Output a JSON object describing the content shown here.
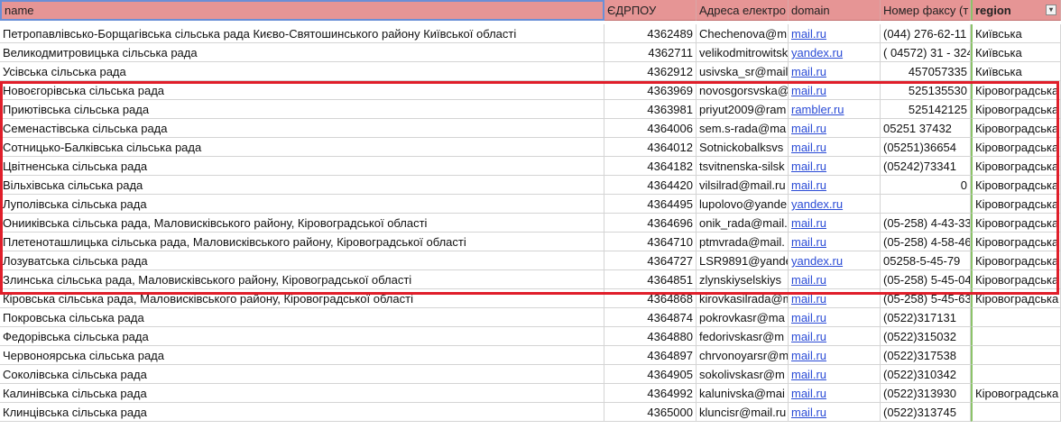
{
  "headers": [
    "name",
    "ЄДРПОУ",
    "Адреса електро",
    "domain",
    "Номер факсу (т",
    "region"
  ],
  "rows": [
    [
      "Петропавлівсько-Борщагівська сільська рада Києво-Святошинського району Київської області",
      "4362489",
      "Chechenova@m",
      "mail.ru",
      "(044) 276-62-11",
      "Київська"
    ],
    [
      "Великодмитровицька  сільська  рада",
      "4362711",
      "velikodmitrowitsk",
      "yandex.ru",
      "( 04572) 31 - 324",
      "Київська"
    ],
    [
      "Усівська сільська рада",
      "4362912",
      "usivska_sr@mail",
      "mail.ru",
      "457057335",
      "Київська"
    ],
    [
      "Новоєгорівська сільська рада",
      "4363969",
      "novosgorsvska@",
      "mail.ru",
      "525135530",
      "Кіровоградська"
    ],
    [
      "Приютівська сільська рада",
      "4363981",
      "priyut2009@ram",
      "rambler.ru",
      "525142125",
      "Кіровоградська"
    ],
    [
      "Семенастівська сільська рада",
      "4364006",
      "sem.s-rada@ma",
      "mail.ru",
      "05251 37432",
      "Кіровоградська"
    ],
    [
      "Сотницько-Балківська сільська рада",
      "4364012",
      "Sotnickobalksvs",
      "mail.ru",
      "(05251)36654",
      "Кіровоградська"
    ],
    [
      "Цвітненська сільська рада",
      "4364182",
      "tsvitnenska-silsk",
      "mail.ru",
      "(05242)73341",
      "Кіровоградська"
    ],
    [
      "Вільхівська сільська рада",
      "4364420",
      "vilsilrad@mail.ru",
      "mail.ru",
      "0",
      "Кіровоградська"
    ],
    [
      "Луполівська сільська рада",
      "4364495",
      "lupolovo@yande",
      "yandex.ru",
      "",
      "Кіровоградська"
    ],
    [
      "Онииківська сільська рада, Маловисківського району, Кіровоградської області",
      "4364696",
      "onik_rada@mail.",
      "mail.ru",
      "(05-258) 4-43-33",
      "Кіровоградська"
    ],
    [
      "Плетенoташлицька сільська рада, Маловисківського району, Кіровоградської області",
      "4364710",
      "ptmvrada@mail.",
      "mail.ru",
      "(05-258) 4-58-46",
      "Кіровоградська"
    ],
    [
      "Лозуватська сільська рада",
      "4364727",
      "LSR9891@yande",
      "yandex.ru",
      "05258-5-45-79",
      "Кіровоградська"
    ],
    [
      "Злинська сільська рада, Маловисківського району, Кіровоградської області",
      "4364851",
      "zlynskiyselskiys",
      "mail.ru",
      "(05-258) 5-45-04",
      "Кіровоградська"
    ],
    [
      "Кіровська сільська рада, Маловисківського району, Кіровоградської області",
      "4364868",
      "kirovkasilrada@m",
      "mail.ru",
      "(05-258) 5-45-63",
      "Кіровоградська"
    ],
    [
      "Покровська сільська рада",
      "4364874",
      "pokrovkasr@ma",
      "mail.ru",
      "(0522)317131",
      ""
    ],
    [
      "Федорівська сільська рада",
      "4364880",
      "fedorivskasr@m",
      "mail.ru",
      "(0522)315032",
      ""
    ],
    [
      "Червоноярська сільська рада",
      "4364897",
      "chrvonoyarsr@m",
      "mail.ru",
      "(0522)317538",
      ""
    ],
    [
      "Соколівська сільська рада",
      "4364905",
      "sokolivskasr@m",
      "mail.ru",
      "(0522)310342",
      ""
    ],
    [
      "Калинівська сільська рада",
      "4364992",
      "kalunivska@mai",
      "mail.ru",
      "(0522)313930",
      "Кіровоградська"
    ],
    [
      "Клинцівська сільська рада",
      "4365000",
      "kluncisr@mail.ru",
      "mail.ru",
      "(0522)313745",
      ""
    ]
  ],
  "icons": {
    "filter": "filter-dropdown-icon"
  },
  "colors": {
    "header_bg": "#e69595",
    "highlight": "#e01e2a",
    "link": "#2a4bd6"
  }
}
